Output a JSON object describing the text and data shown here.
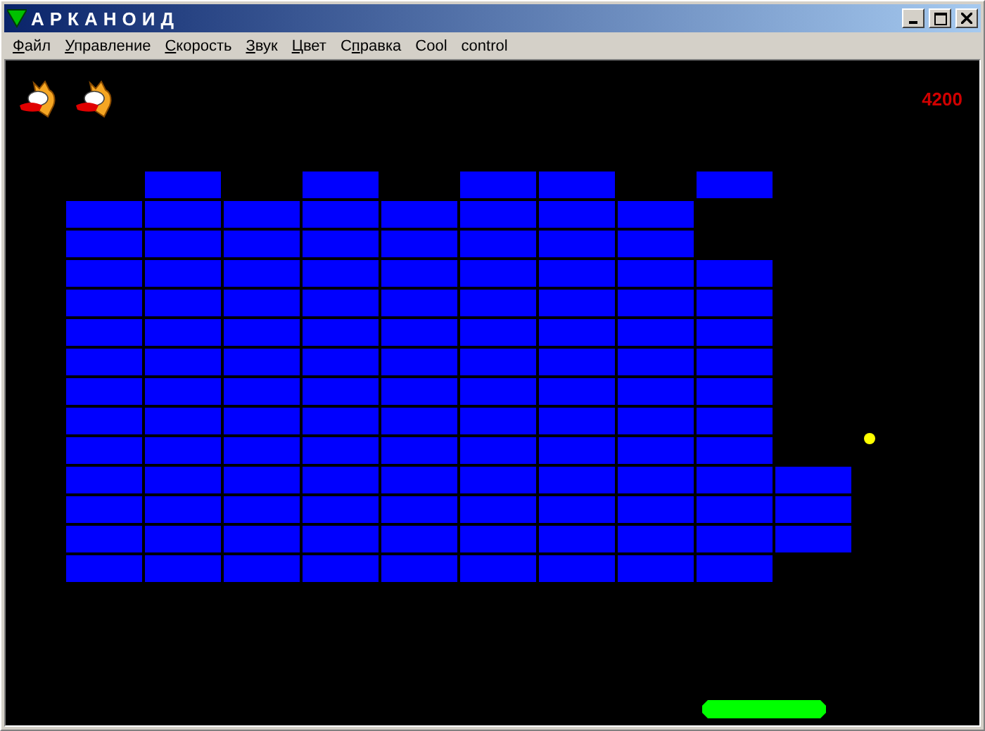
{
  "window": {
    "title": "АРКАНОИД",
    "buttons": [
      {
        "kind": "minimize"
      },
      {
        "kind": "maximize"
      },
      {
        "kind": "close"
      }
    ]
  },
  "menu": [
    {
      "parts": [
        {
          "text": "Ф",
          "underlined": true
        },
        {
          "text": "айл",
          "underlined": false
        }
      ]
    },
    {
      "parts": [
        {
          "text": "У",
          "underlined": true
        },
        {
          "text": "правление",
          "underlined": false
        }
      ]
    },
    {
      "parts": [
        {
          "text": "С",
          "underlined": true
        },
        {
          "text": "корость",
          "underlined": false
        }
      ]
    },
    {
      "parts": [
        {
          "text": "З",
          "underlined": true
        },
        {
          "text": "вук",
          "underlined": false
        }
      ]
    },
    {
      "parts": [
        {
          "text": "Ц",
          "underlined": true
        },
        {
          "text": "вет",
          "underlined": false
        }
      ]
    },
    {
      "parts": [
        {
          "text": "С",
          "underlined": false
        },
        {
          "text": "п",
          "underlined": true
        },
        {
          "text": "равка",
          "underlined": false
        }
      ]
    },
    {
      "parts": [
        {
          "text": "Cool",
          "underlined": false
        }
      ]
    },
    {
      "parts": [
        {
          "text": "control",
          "underlined": false
        }
      ]
    }
  ],
  "game": {
    "lives": [
      {
        "kind": "cat"
      },
      {
        "kind": "cat"
      }
    ],
    "score": "4200",
    "bricks": [
      [
        false,
        true,
        false,
        true,
        false,
        true,
        true,
        false,
        true,
        false
      ],
      [
        true,
        true,
        true,
        true,
        true,
        true,
        true,
        true,
        false,
        false
      ],
      [
        true,
        true,
        true,
        true,
        true,
        true,
        true,
        true,
        false,
        false
      ],
      [
        true,
        true,
        true,
        true,
        true,
        true,
        true,
        true,
        true,
        false
      ],
      [
        true,
        true,
        true,
        true,
        true,
        true,
        true,
        true,
        true,
        false
      ],
      [
        true,
        true,
        true,
        true,
        true,
        true,
        true,
        true,
        true,
        false
      ],
      [
        true,
        true,
        true,
        true,
        true,
        true,
        true,
        true,
        true,
        false
      ],
      [
        true,
        true,
        true,
        true,
        true,
        true,
        true,
        true,
        true,
        false
      ],
      [
        true,
        true,
        true,
        true,
        true,
        true,
        true,
        true,
        true,
        false
      ],
      [
        true,
        true,
        true,
        true,
        true,
        true,
        true,
        true,
        true,
        false
      ],
      [
        true,
        true,
        true,
        true,
        true,
        true,
        true,
        true,
        true,
        true
      ],
      [
        true,
        true,
        true,
        true,
        true,
        true,
        true,
        true,
        true,
        true
      ],
      [
        true,
        true,
        true,
        true,
        true,
        true,
        true,
        true,
        true,
        true
      ],
      [
        true,
        true,
        true,
        true,
        true,
        true,
        true,
        true,
        true,
        false
      ]
    ]
  }
}
